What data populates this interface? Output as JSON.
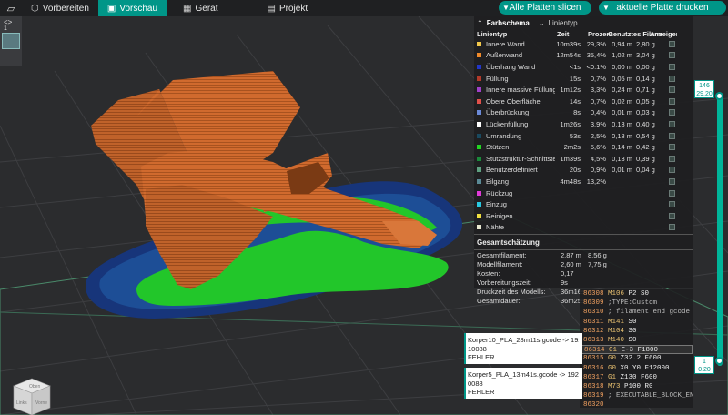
{
  "topbar": {
    "tabs": [
      {
        "label": "Vorbereiten",
        "icon": "cube-icon",
        "active": false
      },
      {
        "label": "Vorschau",
        "icon": "preview-icon",
        "active": true
      },
      {
        "label": "Gerät",
        "icon": "device-icon",
        "active": false
      },
      {
        "label": "Projekt",
        "icon": "project-icon",
        "active": false
      }
    ],
    "slice_all_label": "Alle Platten slicen",
    "print_plate_label": "aktuelle Platte drucken",
    "accent_color": "#009688"
  },
  "plate_panel": {
    "label": "1"
  },
  "legend": {
    "title": "Farbschema",
    "selected_scheme": "Linientyp",
    "columns": [
      "Linientyp",
      "Zeit",
      "Prozent",
      "Genutztes Filament",
      "Anzeigen"
    ],
    "rows": [
      {
        "name": "Innere Wand",
        "color": "#f2c84b",
        "time": "10m39s",
        "percent": "29,3%",
        "fil": "0,94 m",
        "weight": "2,80 g"
      },
      {
        "name": "Außenwand",
        "color": "#f08a2a",
        "time": "12m54s",
        "percent": "35,4%",
        "fil": "1,02 m",
        "weight": "3,04 g"
      },
      {
        "name": "Überhang Wand",
        "color": "#2236c8",
        "time": "<1s",
        "percent": "<0.1%",
        "fil": "0,00 m",
        "weight": "0,00 g"
      },
      {
        "name": "Füllung",
        "color": "#b23a2a",
        "time": "15s",
        "percent": "0,7%",
        "fil": "0,05 m",
        "weight": "0,14 g"
      },
      {
        "name": "Innere massive Füllung",
        "color": "#a040c8",
        "time": "1m12s",
        "percent": "3,3%",
        "fil": "0,24 m",
        "weight": "0,71 g"
      },
      {
        "name": "Obere Oberfläche",
        "color": "#e0504a",
        "time": "14s",
        "percent": "0,7%",
        "fil": "0,02 m",
        "weight": "0,05 g"
      },
      {
        "name": "Überbrückung",
        "color": "#6b8ad8",
        "time": "8s",
        "percent": "0,4%",
        "fil": "0,01 m",
        "weight": "0,03 g"
      },
      {
        "name": "Lückenfüllung",
        "color": "#ffffff",
        "time": "1m26s",
        "percent": "3,9%",
        "fil": "0,13 m",
        "weight": "0,40 g"
      },
      {
        "name": "Umrandung",
        "color": "#1a4a60",
        "time": "53s",
        "percent": "2,5%",
        "fil": "0,18 m",
        "weight": "0,54 g"
      },
      {
        "name": "Stützen",
        "color": "#22d422",
        "time": "2m2s",
        "percent": "5,6%",
        "fil": "0,14 m",
        "weight": "0,42 g"
      },
      {
        "name": "Stützstruktur-Schnittstelle",
        "color": "#1a8a3a",
        "time": "1m39s",
        "percent": "4,5%",
        "fil": "0,13 m",
        "weight": "0,39 g"
      },
      {
        "name": "Benutzerdefiniert",
        "color": "#5ea080",
        "time": "20s",
        "percent": "0,9%",
        "fil": "0,01 m",
        "weight": "0,04 g"
      },
      {
        "name": "Eilgang",
        "color": "#5a8a96",
        "time": "4m48s",
        "percent": "13,2%",
        "fil": "",
        "weight": ""
      },
      {
        "name": "Rückzug",
        "color": "#e03ad8",
        "time": "",
        "percent": "",
        "fil": "",
        "weight": ""
      },
      {
        "name": "Einzug",
        "color": "#28c8e0",
        "time": "",
        "percent": "",
        "fil": "",
        "weight": ""
      },
      {
        "name": "Reinigen",
        "color": "#f0e040",
        "time": "",
        "percent": "",
        "fil": "",
        "weight": ""
      },
      {
        "name": "Nähte",
        "color": "#e8e8d0",
        "time": "",
        "percent": "",
        "fil": "",
        "weight": ""
      }
    ],
    "estimate_title": "Gesamtschätzung",
    "estimates": [
      {
        "key": "Gesamtfilament:",
        "v1": "2,87 m",
        "v2": "8,56 g"
      },
      {
        "key": "Modellfilament:",
        "v1": "2,60 m",
        "v2": "7,75 g"
      },
      {
        "key": "Kosten:",
        "v1": "0,17",
        "v2": ""
      },
      {
        "key": "Vorbereitungszeit:",
        "v1": "9s",
        "v2": ""
      },
      {
        "key": "Druckzeit des Modells:",
        "v1": "36m16s",
        "v2": ""
      },
      {
        "key": "Gesamtdauer:",
        "v1": "36m25s",
        "v2": ""
      }
    ]
  },
  "gcode": [
    {
      "num": "86308",
      "cmd": "M106",
      "rest": " P2 S0"
    },
    {
      "num": "86309",
      "cmd": "",
      "rest": " ;TYPE:Custom"
    },
    {
      "num": "86310",
      "cmd": "",
      "rest": " ; filament end gcode"
    },
    {
      "num": "86311",
      "cmd": "M141",
      "rest": " S0"
    },
    {
      "num": "86312",
      "cmd": "M104",
      "rest": " S0"
    },
    {
      "num": "86313",
      "cmd": "M140",
      "rest": " S0"
    },
    {
      "num": "86314",
      "cmd": "G1",
      "rest": " E-3 F1800"
    },
    {
      "num": "86315",
      "cmd": "G0",
      "rest": " Z32.2 F600"
    },
    {
      "num": "86316",
      "cmd": "G0",
      "rest": " X0 Y0 F12000"
    },
    {
      "num": "86317",
      "cmd": "G1",
      "rest": " Z130 F600"
    },
    {
      "num": "86318",
      "cmd": "M73",
      "rest": " P100 R0"
    },
    {
      "num": "86319",
      "cmd": "",
      "rest": " ; EXECUTABLE_BLOCK_END"
    },
    {
      "num": "86320",
      "cmd": "",
      "rest": ""
    }
  ],
  "notifications": [
    {
      "line1": "Korper10_PLA_28m11s.gcode -> 192.1",
      "line2": "10088",
      "line3": "FEHLER"
    },
    {
      "line1": "Korper5_PLA_13m41s.gcode -> 192.1",
      "line2": "0088",
      "line3": "FEHLER"
    }
  ],
  "slider": {
    "top_label_1": "146",
    "top_label_2": "29.20",
    "bottom_label_1": "1",
    "bottom_label_2": "0.20"
  },
  "view_cube": {
    "top_face": "Oben",
    "left_face": "Links",
    "front_face": "Vorne"
  }
}
